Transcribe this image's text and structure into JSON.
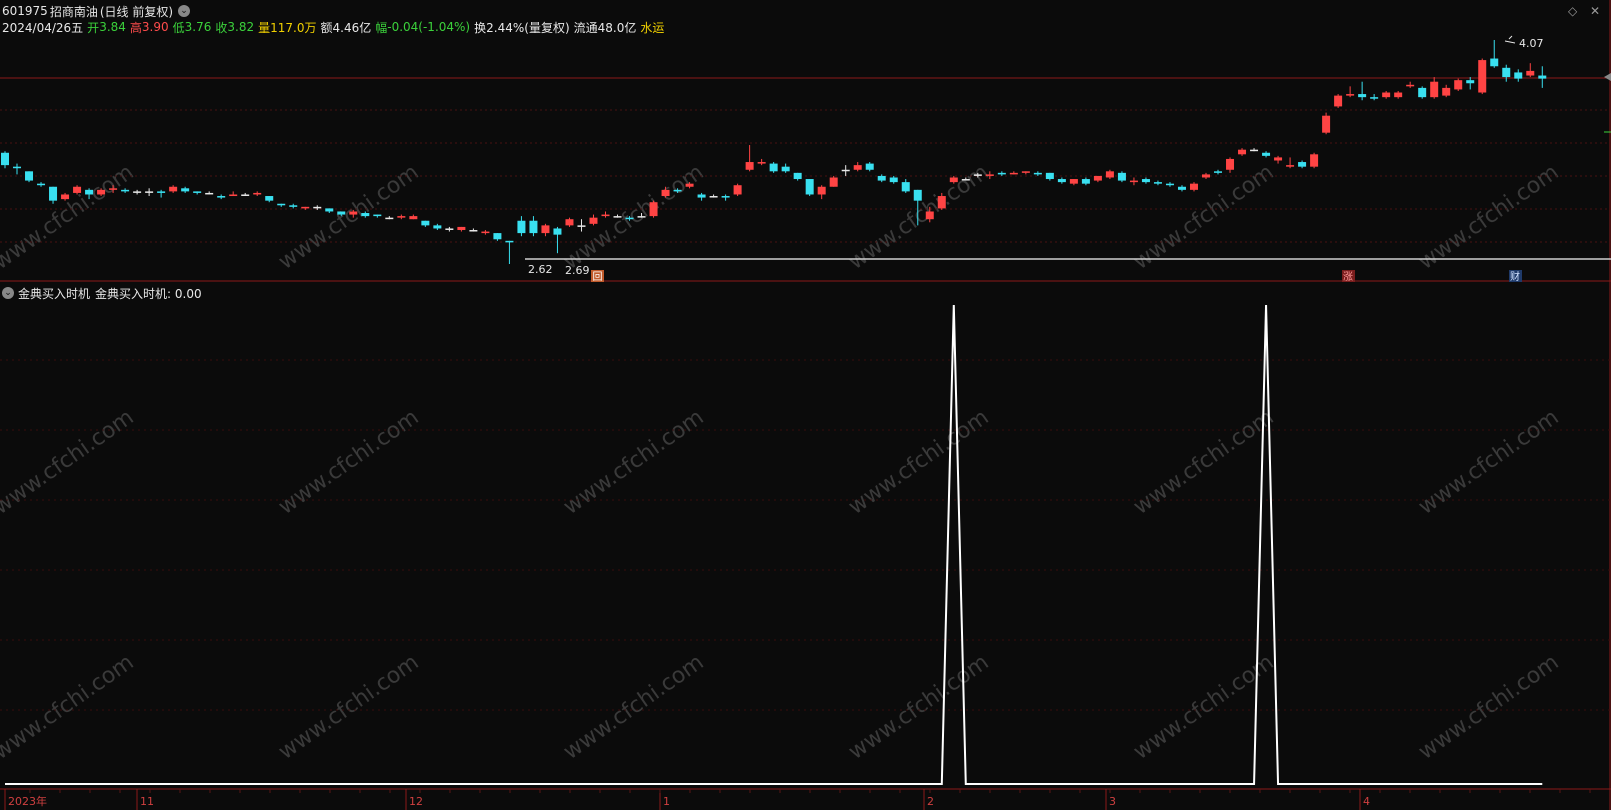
{
  "header": {
    "code": "601975",
    "name": "招商南油",
    "period": "(日线 前复权)"
  },
  "quote": {
    "date": "2024/04/26五",
    "open_label": "开",
    "open": "3.84",
    "high_label": "高",
    "high": "3.90",
    "low_label": "低",
    "low": "3.76",
    "close_label": "收",
    "close": "3.82",
    "vol_label": "量",
    "vol": "117.0万",
    "amt_label": "额",
    "amt": "4.46亿",
    "chg_label": "幅",
    "chg": "-0.04(-1.04%)",
    "turn_label": "换",
    "turn": "2.44%(量复权)",
    "float_label": "流通",
    "float": "48.0亿",
    "sector": "水运"
  },
  "price_labels": {
    "high": "4.07",
    "low": "2.62",
    "low2": "2.69"
  },
  "markers": {
    "zhang": "涨",
    "cai": "财",
    "hui": "回"
  },
  "indicator": {
    "title": "金典买入时机",
    "line": "金典买入时机: 0.00"
  },
  "time_axis": [
    "2023年",
    "11",
    "12",
    "1",
    "2",
    "3",
    "4"
  ],
  "watermark": "www.cfchi.com",
  "colors": {
    "up": "#ff4444",
    "down": "#39e0f0",
    "grid": "#5a1111",
    "axis": "#8b1a1a"
  },
  "chart_data": {
    "type": "candlestick",
    "candles": [
      [
        3.34,
        3.26,
        3.35,
        3.24
      ],
      [
        3.25,
        3.24,
        3.27,
        3.2
      ],
      [
        3.22,
        3.16,
        3.22,
        3.15
      ],
      [
        3.14,
        3.13,
        3.15,
        3.12
      ],
      [
        3.12,
        3.03,
        3.12,
        3.01
      ],
      [
        3.04,
        3.07,
        3.08,
        3.03
      ],
      [
        3.08,
        3.12,
        3.13,
        3.07
      ],
      [
        3.1,
        3.07,
        3.11,
        3.04
      ],
      [
        3.07,
        3.1,
        3.11,
        3.06
      ],
      [
        3.1,
        3.11,
        3.13,
        3.08
      ],
      [
        3.1,
        3.09,
        3.11,
        3.08
      ],
      [
        3.09,
        3.09,
        3.1,
        3.07
      ],
      [
        3.09,
        3.09,
        3.11,
        3.06
      ],
      [
        3.09,
        3.08,
        3.1,
        3.05
      ],
      [
        3.09,
        3.12,
        3.13,
        3.08
      ],
      [
        3.11,
        3.09,
        3.12,
        3.08
      ],
      [
        3.09,
        3.08,
        3.09,
        3.07
      ],
      [
        3.08,
        3.08,
        3.09,
        3.07
      ],
      [
        3.06,
        3.05,
        3.07,
        3.04
      ],
      [
        3.06,
        3.07,
        3.09,
        3.06
      ],
      [
        3.07,
        3.07,
        3.08,
        3.06
      ],
      [
        3.07,
        3.08,
        3.09,
        3.06
      ],
      [
        3.06,
        3.03,
        3.06,
        3.02
      ],
      [
        3.01,
        3.0,
        3.01,
        2.99
      ],
      [
        3.0,
        2.99,
        3.01,
        2.98
      ],
      [
        2.98,
        2.99,
        2.99,
        2.97
      ],
      [
        2.99,
        2.99,
        3.0,
        2.97
      ],
      [
        2.98,
        2.96,
        2.98,
        2.95
      ],
      [
        2.96,
        2.94,
        2.96,
        2.93
      ],
      [
        2.94,
        2.96,
        2.97,
        2.92
      ],
      [
        2.95,
        2.93,
        2.96,
        2.92
      ],
      [
        2.94,
        2.93,
        2.94,
        2.92
      ],
      [
        2.92,
        2.92,
        2.93,
        2.91
      ],
      [
        2.92,
        2.93,
        2.94,
        2.91
      ],
      [
        2.91,
        2.93,
        2.94,
        2.91
      ],
      [
        2.9,
        2.87,
        2.9,
        2.86
      ],
      [
        2.87,
        2.85,
        2.88,
        2.84
      ],
      [
        2.85,
        2.85,
        2.86,
        2.83
      ],
      [
        2.84,
        2.86,
        2.86,
        2.83
      ],
      [
        2.84,
        2.84,
        2.85,
        2.83
      ],
      [
        2.82,
        2.83,
        2.84,
        2.81
      ],
      [
        2.82,
        2.78,
        2.82,
        2.77
      ],
      [
        2.77,
        2.76,
        2.77,
        2.62
      ],
      [
        2.9,
        2.82,
        2.93,
        2.8
      ],
      [
        2.9,
        2.82,
        2.93,
        2.8
      ],
      [
        2.82,
        2.87,
        2.88,
        2.8
      ],
      [
        2.85,
        2.81,
        2.86,
        2.69
      ],
      [
        2.87,
        2.91,
        2.92,
        2.86
      ],
      [
        2.87,
        2.87,
        2.91,
        2.83
      ],
      [
        2.88,
        2.92,
        2.94,
        2.87
      ],
      [
        2.93,
        2.94,
        2.96,
        2.92
      ],
      [
        2.93,
        2.93,
        2.94,
        2.92
      ],
      [
        2.92,
        2.91,
        2.93,
        2.9
      ],
      [
        2.93,
        2.93,
        2.95,
        2.92
      ],
      [
        2.93,
        3.02,
        3.03,
        2.92
      ],
      [
        3.06,
        3.1,
        3.12,
        3.05
      ],
      [
        3.1,
        3.09,
        3.11,
        3.08
      ],
      [
        3.12,
        3.14,
        3.15,
        3.11
      ],
      [
        3.07,
        3.05,
        3.08,
        3.03
      ],
      [
        3.06,
        3.06,
        3.07,
        3.05
      ],
      [
        3.06,
        3.05,
        3.07,
        3.03
      ],
      [
        3.07,
        3.13,
        3.14,
        3.06
      ],
      [
        3.23,
        3.28,
        3.39,
        3.22
      ],
      [
        3.27,
        3.28,
        3.3,
        3.26
      ],
      [
        3.27,
        3.22,
        3.28,
        3.21
      ],
      [
        3.25,
        3.22,
        3.27,
        3.21
      ],
      [
        3.21,
        3.17,
        3.21,
        3.16
      ],
      [
        3.17,
        3.07,
        3.17,
        3.06
      ],
      [
        3.07,
        3.12,
        3.13,
        3.04
      ],
      [
        3.12,
        3.18,
        3.19,
        3.12
      ],
      [
        3.23,
        3.23,
        3.26,
        3.19
      ],
      [
        3.23,
        3.26,
        3.28,
        3.22
      ],
      [
        3.27,
        3.23,
        3.28,
        3.22
      ],
      [
        3.19,
        3.16,
        3.2,
        3.15
      ],
      [
        3.18,
        3.15,
        3.19,
        3.14
      ],
      [
        3.15,
        3.09,
        3.17,
        3.08
      ],
      [
        3.1,
        3.03,
        3.1,
        2.87
      ],
      [
        2.91,
        2.96,
        2.99,
        2.89
      ],
      [
        2.98,
        3.06,
        3.08,
        2.97
      ],
      [
        3.15,
        3.18,
        3.19,
        3.14
      ],
      [
        3.17,
        3.17,
        3.18,
        3.16
      ],
      [
        3.2,
        3.2,
        3.21,
        3.18
      ],
      [
        3.19,
        3.2,
        3.22,
        3.17
      ],
      [
        3.21,
        3.2,
        3.22,
        3.19
      ],
      [
        3.2,
        3.21,
        3.22,
        3.2
      ],
      [
        3.21,
        3.22,
        3.22,
        3.2
      ],
      [
        3.21,
        3.2,
        3.22,
        3.19
      ],
      [
        3.21,
        3.17,
        3.21,
        3.16
      ],
      [
        3.17,
        3.15,
        3.18,
        3.14
      ],
      [
        3.14,
        3.17,
        3.17,
        3.13
      ],
      [
        3.17,
        3.14,
        3.18,
        3.13
      ],
      [
        3.16,
        3.19,
        3.19,
        3.15
      ],
      [
        3.18,
        3.22,
        3.23,
        3.17
      ],
      [
        3.21,
        3.16,
        3.22,
        3.15
      ],
      [
        3.15,
        3.16,
        3.18,
        3.13
      ],
      [
        3.17,
        3.15,
        3.18,
        3.14
      ],
      [
        3.15,
        3.14,
        3.16,
        3.13
      ],
      [
        3.14,
        3.13,
        3.15,
        3.12
      ],
      [
        3.12,
        3.1,
        3.13,
        3.09
      ],
      [
        3.1,
        3.14,
        3.15,
        3.09
      ],
      [
        3.18,
        3.2,
        3.21,
        3.17
      ],
      [
        3.22,
        3.21,
        3.23,
        3.2
      ],
      [
        3.23,
        3.3,
        3.31,
        3.21
      ],
      [
        3.33,
        3.36,
        3.37,
        3.32
      ],
      [
        3.36,
        3.36,
        3.37,
        3.35
      ],
      [
        3.34,
        3.32,
        3.35,
        3.31
      ],
      [
        3.29,
        3.31,
        3.32,
        3.27
      ],
      [
        3.25,
        3.26,
        3.31,
        3.24
      ],
      [
        3.28,
        3.25,
        3.29,
        3.24
      ],
      [
        3.25,
        3.33,
        3.34,
        3.24
      ],
      [
        3.47,
        3.58,
        3.6,
        3.46
      ],
      [
        3.64,
        3.71,
        3.72,
        3.63
      ],
      [
        3.71,
        3.72,
        3.77,
        3.7
      ],
      [
        3.72,
        3.7,
        3.8,
        3.68
      ],
      [
        3.7,
        3.69,
        3.72,
        3.68
      ],
      [
        3.7,
        3.73,
        3.74,
        3.69
      ],
      [
        3.7,
        3.73,
        3.74,
        3.69
      ],
      [
        3.77,
        3.78,
        3.8,
        3.76
      ],
      [
        3.76,
        3.7,
        3.77,
        3.69
      ],
      [
        3.7,
        3.8,
        3.83,
        3.69
      ],
      [
        3.71,
        3.76,
        3.78,
        3.7
      ],
      [
        3.75,
        3.81,
        3.82,
        3.74
      ],
      [
        3.81,
        3.79,
        3.83,
        3.75
      ],
      [
        3.73,
        3.94,
        3.95,
        3.72
      ],
      [
        3.95,
        3.9,
        4.07,
        3.89
      ],
      [
        3.89,
        3.83,
        3.91,
        3.8
      ],
      [
        3.86,
        3.82,
        3.88,
        3.8
      ],
      [
        3.84,
        3.87,
        3.92,
        3.83
      ],
      [
        3.84,
        3.82,
        3.9,
        3.76
      ]
    ],
    "indicator_peaks": [
      {
        "index": 79,
        "value": 1
      },
      {
        "index": 105,
        "value": 1
      }
    ]
  }
}
